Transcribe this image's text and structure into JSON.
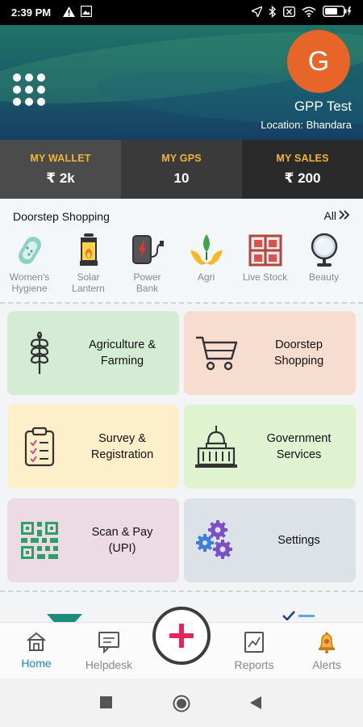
{
  "status_bar": {
    "time": "2:39 PM",
    "left_icons": [
      "alert-icon",
      "image-icon"
    ],
    "right_icons": [
      "location-arrow-icon",
      "bluetooth-icon",
      "close-box-icon",
      "wifi-icon",
      "battery-charging-icon"
    ]
  },
  "header": {
    "avatar_letter": "G",
    "user_name": "GPP Test",
    "location": "Location: Bhandara",
    "menu_icon": "grid-menu-icon"
  },
  "stats": [
    {
      "label": "MY WALLET",
      "value": "₹ 2k"
    },
    {
      "label": "MY GPS",
      "value": "10"
    },
    {
      "label": "MY SALES",
      "value": "₹ 200"
    }
  ],
  "doorstep": {
    "title": "Doorstep Shopping",
    "all_label": "All",
    "items": [
      {
        "label_line1": "Women's",
        "label_line2": "Hygiene",
        "icon": "sanitary-pad-icon"
      },
      {
        "label_line1": "Solar",
        "label_line2": "Lantern",
        "icon": "lantern-icon"
      },
      {
        "label_line1": "Power",
        "label_line2": "Bank",
        "icon": "power-bank-icon"
      },
      {
        "label_line1": "Agri",
        "label_line2": "",
        "icon": "sprout-icon"
      },
      {
        "label_line1": "Live Stock",
        "label_line2": "",
        "icon": "livestock-icon"
      },
      {
        "label_line1": "Beauty",
        "label_line2": "",
        "icon": "mirror-icon"
      }
    ]
  },
  "tiles": [
    {
      "line1": "Agriculture &",
      "line2": "Farming",
      "icon": "wheat-icon"
    },
    {
      "line1": "Doorstep",
      "line2": "Shopping",
      "icon": "cart-icon"
    },
    {
      "line1": "Survey &",
      "line2": "Registration",
      "icon": "clipboard-icon"
    },
    {
      "line1": "Government",
      "line2": "Services",
      "icon": "capitol-icon"
    },
    {
      "line1": "Scan & Pay",
      "line2": "(UPI)",
      "icon": "qr-code-icon"
    },
    {
      "line1": "Settings",
      "line2": "",
      "icon": "gears-icon"
    }
  ],
  "bottom_nav": {
    "items": [
      {
        "label": "Home",
        "icon": "home-icon"
      },
      {
        "label": "Helpdesk",
        "icon": "chat-icon"
      },
      {
        "label": "Reports",
        "icon": "chart-icon"
      },
      {
        "label": "Alerts",
        "icon": "bell-icon"
      }
    ],
    "fab_icon": "plus-icon"
  },
  "colors": {
    "accent": "#1a86c8",
    "avatar": "#e8652a",
    "stat_label": "#f2b632",
    "fab_plus": "#e4245a"
  }
}
